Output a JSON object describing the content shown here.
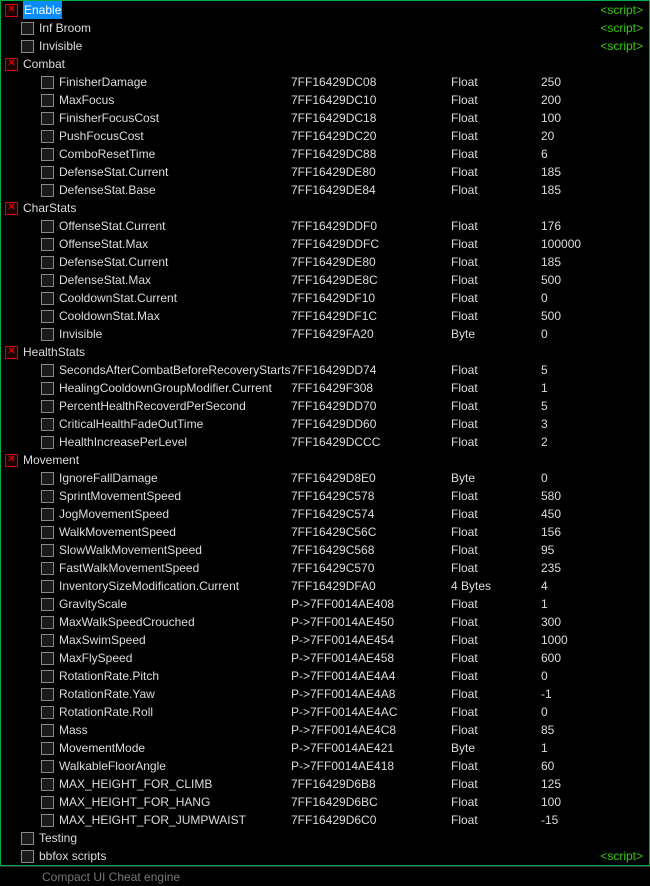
{
  "footer": "Compact UI Cheat engine",
  "script_tag": "<script>",
  "rows": [
    {
      "indent": 0,
      "box": "red",
      "desc": "Enable",
      "highlight": true,
      "script": true
    },
    {
      "indent": 1,
      "box": "empty",
      "desc": "Inf Broom",
      "script": true
    },
    {
      "indent": 1,
      "box": "empty",
      "desc": "Invisible",
      "script": true
    },
    {
      "indent": 0,
      "box": "red",
      "desc": "Combat"
    },
    {
      "indent": 2,
      "box": "empty",
      "desc": "FinisherDamage",
      "addr": "7FF16429DC08",
      "type": "Float",
      "val": "250"
    },
    {
      "indent": 2,
      "box": "empty",
      "desc": "MaxFocus",
      "addr": "7FF16429DC10",
      "type": "Float",
      "val": "200"
    },
    {
      "indent": 2,
      "box": "empty",
      "desc": "FinisherFocusCost",
      "addr": "7FF16429DC18",
      "type": "Float",
      "val": "100"
    },
    {
      "indent": 2,
      "box": "empty",
      "desc": "PushFocusCost",
      "addr": "7FF16429DC20",
      "type": "Float",
      "val": "20"
    },
    {
      "indent": 2,
      "box": "empty",
      "desc": "ComboResetTime",
      "addr": "7FF16429DC88",
      "type": "Float",
      "val": "6"
    },
    {
      "indent": 2,
      "box": "empty",
      "desc": "DefenseStat.Current",
      "addr": "7FF16429DE80",
      "type": "Float",
      "val": "185"
    },
    {
      "indent": 2,
      "box": "empty",
      "desc": "DefenseStat.Base",
      "addr": "7FF16429DE84",
      "type": "Float",
      "val": "185"
    },
    {
      "indent": 0,
      "box": "red",
      "desc": "CharStats"
    },
    {
      "indent": 2,
      "box": "empty",
      "desc": "OffenseStat.Current",
      "addr": "7FF16429DDF0",
      "type": "Float",
      "val": "176"
    },
    {
      "indent": 2,
      "box": "empty",
      "desc": "OffenseStat.Max",
      "addr": "7FF16429DDFC",
      "type": "Float",
      "val": "100000"
    },
    {
      "indent": 2,
      "box": "empty",
      "desc": "DefenseStat.Current",
      "addr": "7FF16429DE80",
      "type": "Float",
      "val": "185"
    },
    {
      "indent": 2,
      "box": "empty",
      "desc": "DefenseStat.Max",
      "addr": "7FF16429DE8C",
      "type": "Float",
      "val": "500"
    },
    {
      "indent": 2,
      "box": "empty",
      "desc": "CooldownStat.Current",
      "addr": "7FF16429DF10",
      "type": "Float",
      "val": "0"
    },
    {
      "indent": 2,
      "box": "empty",
      "desc": "CooldownStat.Max",
      "addr": "7FF16429DF1C",
      "type": "Float",
      "val": "500"
    },
    {
      "indent": 2,
      "box": "empty",
      "desc": "Invisible",
      "addr": "7FF16429FA20",
      "type": "Byte",
      "val": "0"
    },
    {
      "indent": 0,
      "box": "red",
      "desc": "HealthStats"
    },
    {
      "indent": 2,
      "box": "empty",
      "desc": "SecondsAfterCombatBeforeRecoveryStarts",
      "addr": "7FF16429DD74",
      "type": "Float",
      "val": "5"
    },
    {
      "indent": 2,
      "box": "empty",
      "desc": "HealingCooldownGroupModifier.Current",
      "addr": "7FF16429F308",
      "type": "Float",
      "val": "1"
    },
    {
      "indent": 2,
      "box": "empty",
      "desc": "PercentHealthRecoverdPerSecond",
      "addr": "7FF16429DD70",
      "type": "Float",
      "val": "5"
    },
    {
      "indent": 2,
      "box": "empty",
      "desc": "CriticalHealthFadeOutTime",
      "addr": "7FF16429DD60",
      "type": "Float",
      "val": "3"
    },
    {
      "indent": 2,
      "box": "empty",
      "desc": "HealthIncreasePerLevel",
      "addr": "7FF16429DCCC",
      "type": "Float",
      "val": "2"
    },
    {
      "indent": 0,
      "box": "red",
      "desc": "Movement"
    },
    {
      "indent": 2,
      "box": "empty",
      "desc": "IgnoreFallDamage",
      "addr": "7FF16429D8E0",
      "type": "Byte",
      "val": "0"
    },
    {
      "indent": 2,
      "box": "empty",
      "desc": "SprintMovementSpeed",
      "addr": "7FF16429C578",
      "type": "Float",
      "val": "580"
    },
    {
      "indent": 2,
      "box": "empty",
      "desc": "JogMovementSpeed",
      "addr": "7FF16429C574",
      "type": "Float",
      "val": "450"
    },
    {
      "indent": 2,
      "box": "empty",
      "desc": "WalkMovementSpeed",
      "addr": "7FF16429C56C",
      "type": "Float",
      "val": "156"
    },
    {
      "indent": 2,
      "box": "empty",
      "desc": "SlowWalkMovementSpeed",
      "addr": "7FF16429C568",
      "type": "Float",
      "val": "95"
    },
    {
      "indent": 2,
      "box": "empty",
      "desc": "FastWalkMovementSpeed",
      "addr": "7FF16429C570",
      "type": "Float",
      "val": "235"
    },
    {
      "indent": 2,
      "box": "empty",
      "desc": "InventorySizeModification.Current",
      "addr": "7FF16429DFA0",
      "type": "4 Bytes",
      "val": "4"
    },
    {
      "indent": 2,
      "box": "empty",
      "desc": "GravityScale",
      "addr": "P->7FF0014AE408",
      "type": "Float",
      "val": "1"
    },
    {
      "indent": 2,
      "box": "empty",
      "desc": "MaxWalkSpeedCrouched",
      "addr": "P->7FF0014AE450",
      "type": "Float",
      "val": "300"
    },
    {
      "indent": 2,
      "box": "empty",
      "desc": "MaxSwimSpeed",
      "addr": "P->7FF0014AE454",
      "type": "Float",
      "val": "1000"
    },
    {
      "indent": 2,
      "box": "empty",
      "desc": "MaxFlySpeed",
      "addr": "P->7FF0014AE458",
      "type": "Float",
      "val": "600"
    },
    {
      "indent": 2,
      "box": "empty",
      "desc": "RotationRate.Pitch",
      "addr": "P->7FF0014AE4A4",
      "type": "Float",
      "val": "0"
    },
    {
      "indent": 2,
      "box": "empty",
      "desc": "RotationRate.Yaw",
      "addr": "P->7FF0014AE4A8",
      "type": "Float",
      "val": "-1"
    },
    {
      "indent": 2,
      "box": "empty",
      "desc": "RotationRate.Roll",
      "addr": "P->7FF0014AE4AC",
      "type": "Float",
      "val": "0"
    },
    {
      "indent": 2,
      "box": "empty",
      "desc": "Mass",
      "addr": "P->7FF0014AE4C8",
      "type": "Float",
      "val": "85"
    },
    {
      "indent": 2,
      "box": "empty",
      "desc": "MovementMode",
      "addr": "P->7FF0014AE421",
      "type": "Byte",
      "val": "1"
    },
    {
      "indent": 2,
      "box": "empty",
      "desc": "WalkableFloorAngle",
      "addr": "P->7FF0014AE418",
      "type": "Float",
      "val": "60"
    },
    {
      "indent": 2,
      "box": "empty",
      "desc": "MAX_HEIGHT_FOR_CLIMB",
      "addr": "7FF16429D6B8",
      "type": "Float",
      "val": "125"
    },
    {
      "indent": 2,
      "box": "empty",
      "desc": "MAX_HEIGHT_FOR_HANG",
      "addr": "7FF16429D6BC",
      "type": "Float",
      "val": "100"
    },
    {
      "indent": 2,
      "box": "empty",
      "desc": "MAX_HEIGHT_FOR_JUMPWAIST",
      "addr": "7FF16429D6C0",
      "type": "Float",
      "val": "-15"
    },
    {
      "indent": 1,
      "box": "empty",
      "desc": "Testing"
    },
    {
      "indent": 1,
      "box": "empty",
      "desc": "bbfox scripts",
      "script": true
    }
  ]
}
